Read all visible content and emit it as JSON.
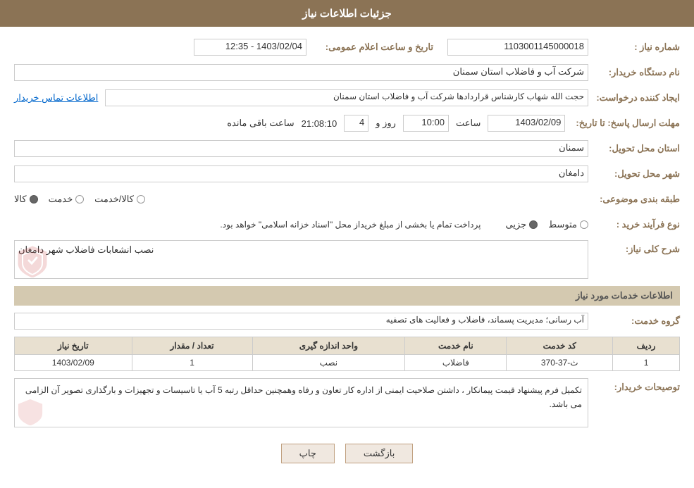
{
  "header": {
    "title": "جزئیات اطلاعات نیاز"
  },
  "fields": {
    "shomara_niaz_label": "شماره نیاز :",
    "shomara_niaz_value": "1103001145000018",
    "nam_dastgah_label": "نام دستگاه خریدار:",
    "nam_dastgah_value": "شرکت آب و فاضلاب استان سمنان",
    "ijad_konande_label": "ایجاد کننده درخواست:",
    "ijad_konande_value": "حجت الله شهاب کارشناس قراردادها شرکت آب و فاضلاب استان سمنان",
    "mohlat_label": "مهلت ارسال پاسخ: تا تاریخ:",
    "mohlat_date": "1403/02/09",
    "mohlat_saat_label": "ساعت",
    "mohlat_saat_value": "10:00",
    "mohlat_roz_label": "روز و",
    "mohlat_roz_value": "4",
    "mohlat_saat2_value": "21:08:10",
    "mohlat_baqi_label": "ساعت باقی مانده",
    "ostan_label": "استان محل تحویل:",
    "ostan_value": "سمنان",
    "shahr_label": "شهر محل تحویل:",
    "shahr_value": "دامغان",
    "tabaqe_label": "طبقه بندی موضوعی:",
    "tabaqe_kala": "کالا",
    "tabaqe_khadamat": "خدمت",
    "tabaqe_kala_khadamat": "کالا/خدمت",
    "nooa_farind_label": "نوع فرآیند خرید :",
    "nooa_farind_jozei": "جزیی",
    "nooa_farind_motawaset": "متوسط",
    "nooa_farind_desc": "پرداخت تمام یا بخشی از مبلغ خریداز محل \"اسناد خزانه اسلامی\" خواهد بود.",
    "sharh_niaz_label": "شرح کلی نیاز:",
    "sharh_niaz_value": "نصب انشعابات فاضلاب شهر دامغان",
    "khadamat_label": "اطلاعات خدمات مورد نیاز",
    "gorooh_label": "گروه خدمت:",
    "gorooh_value": "آب رسانی؛ مدیریت پسماند، فاضلاب و فعالیت های تصفیه",
    "table": {
      "headers": [
        "ردیف",
        "کد خدمت",
        "نام خدمت",
        "واحد اندازه گیری",
        "تعداد / مقدار",
        "تاریخ نیاز"
      ],
      "rows": [
        [
          "1",
          "ث-37-370",
          "فاضلاب",
          "نصب",
          "1",
          "1403/02/09"
        ]
      ]
    },
    "tawsia_label": "توصیحات خریدار:",
    "tawsia_value": "تکمیل فرم پیشنهاد قیمت پیمانکار ، داشتن صلاحیت ایمنی از اداره کار تعاون و رفاه وهمچنین حداقل رتبه 5 آب یا تاسیسات و تجهیزات و بارگذاری تصویر آن الزامی می باشد.",
    "btn_back": "بازگشت",
    "btn_print": "چاپ",
    "etelaat_tamas_label": "اطلاعات تماس خریدار",
    "tarikh_label": "تاریخ و ساعت اعلام عمومی:",
    "tarikh_value": "1403/02/04 - 12:35"
  }
}
